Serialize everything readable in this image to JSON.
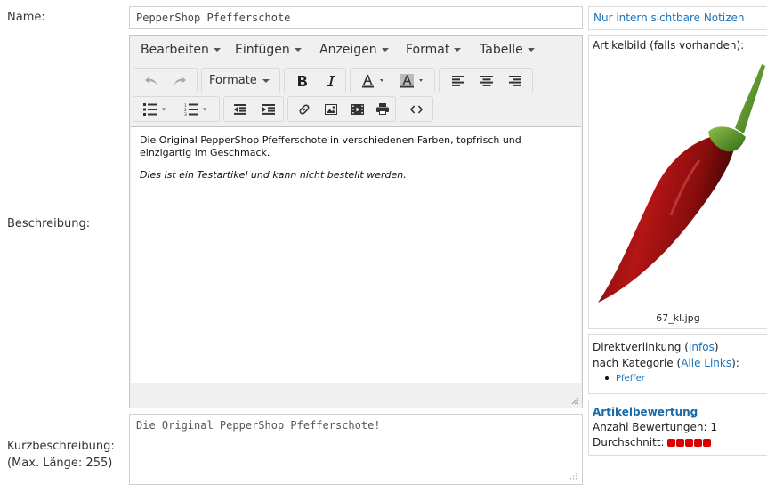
{
  "labels": {
    "name": "Name:",
    "beschreibung": "Beschreibung:",
    "kurzbeschreibung": "Kurzbeschreibung:",
    "max_laenge": "(Max. Länge: 255)"
  },
  "name_field": {
    "value": "PepperShop Pfefferschote"
  },
  "editor": {
    "menu": [
      "Bearbeiten",
      "Einfügen",
      "Anzeigen",
      "Format",
      "Tabelle"
    ],
    "formate_label": "Formate",
    "content": {
      "p1": "Die Original PepperShop Pfefferschote in verschiedenen Farben, topfrisch und einzigartig im Geschmack.",
      "p2": "Dies ist ein Testartikel und kann nicht bestellt werden."
    }
  },
  "kurz_field": {
    "value": "Die Original PepperShop Pfefferschote!"
  },
  "sidebar": {
    "notes_link": "Nur intern sichtbare Notizen",
    "artikelbild_label": "Artikelbild (falls vorhanden):",
    "image_filename": "67_kl.jpg",
    "direktverlinkung": "Direktverlinkung (",
    "infos_link": "Infos",
    "close_paren": ")",
    "nach_kategorie": "nach Kategorie (",
    "alle_links": "Alle Links",
    "close_paren_colon": "):",
    "kategorie": "Pfeffer",
    "bewertung_title": "Artikelbewertung",
    "anzahl": "Anzahl Bewertungen: 1",
    "durchschnitt": "Durchschnitt:",
    "rating_value": 5,
    "rating_max": 5
  },
  "colors": {
    "link": "#1a73b8",
    "rating": "#dd0000",
    "pepper": "#b51515"
  }
}
